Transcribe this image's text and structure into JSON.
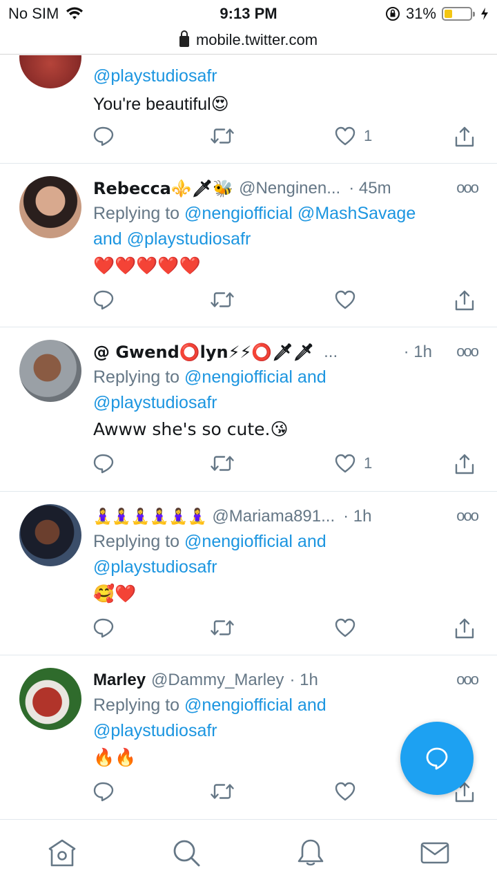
{
  "status_bar": {
    "carrier": "No SIM",
    "time": "9:13 PM",
    "battery": "31%",
    "battery_level": 0.31
  },
  "url_bar": {
    "url": "mobile.twitter.com"
  },
  "tweets": [
    {
      "handle_line_reply": "@playstudiosafr",
      "text": "You're beautiful😍",
      "like_count": "1"
    },
    {
      "name": "Rebecca⚜️🗡🐝",
      "handle": "@Nenginen...",
      "time": "· 45m",
      "reply_prefix": "Replying to ",
      "reply_targets_1": "@nengiofficial @MashSavage",
      "reply_and": "and ",
      "reply_targets_2": "@playstudiosafr",
      "text": "❤️❤️❤️❤️❤️",
      "like_count": ""
    },
    {
      "name": "@ Gwend⭕lyn⚡⚡⭕🗡🗡",
      "ellipsis": "...",
      "time": "· 1h",
      "reply_prefix": "Replying to ",
      "reply_targets_1": "@nengiofficial and",
      "reply_targets_2": "@playstudiosafr",
      "text": "Awww she's so cute.😘",
      "like_count": "1"
    },
    {
      "name": "🧘‍♀️🧘‍♀️🧘‍♀️🧘‍♀️🧘‍♀️🧘‍♀️",
      "handle": "@Mariama891...",
      "time": "· 1h",
      "reply_prefix": "Replying to ",
      "reply_targets_1": "@nengiofficial and",
      "reply_targets_2": "@playstudiosafr",
      "text": "🥰❤️",
      "like_count": ""
    },
    {
      "name": "Marley",
      "handle": "@Dammy_Marley",
      "time": "· 1h",
      "reply_prefix": "Replying to ",
      "reply_targets_1": "@nengiofficial and",
      "reply_targets_2": "@playstudiosafr",
      "text": "🔥🔥",
      "like_count": ""
    }
  ],
  "icons": {
    "reply": "reply-icon",
    "retweet": "retweet-icon",
    "like": "heart-icon",
    "share": "share-icon",
    "more": "more-icon",
    "compose": "compose-reply-icon",
    "home": "home-icon",
    "search": "search-icon",
    "notifications": "bell-icon",
    "messages": "mail-icon"
  },
  "colors": {
    "accent": "#1da1f2",
    "link": "#1b95e0",
    "muted": "#657786"
  }
}
